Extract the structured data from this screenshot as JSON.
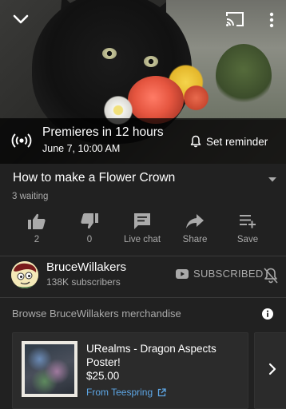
{
  "premiere": {
    "title": "Premieres in 12 hours",
    "date": "June 7, 10:00 AM",
    "reminder_label": "Set reminder"
  },
  "video": {
    "title": "How to make a Flower Crown",
    "waiting": "3 waiting"
  },
  "actions": [
    {
      "label": "2",
      "icon": "thumbs-up-icon"
    },
    {
      "label": "0",
      "icon": "thumbs-down-icon"
    },
    {
      "label": "Live chat",
      "icon": "chat-icon"
    },
    {
      "label": "Share",
      "icon": "share-icon"
    },
    {
      "label": "Save",
      "icon": "add-to-playlist-icon"
    }
  ],
  "channel": {
    "name": "BruceWillakers",
    "subscribers": "138K subscribers",
    "subscribed_label": "SUBSCRIBED"
  },
  "merch": {
    "heading": "Browse BruceWillakers merchandise",
    "item": {
      "title": "URealms - Dragon Aspects Poster!",
      "price": "$25.00",
      "source": "From Teespring"
    }
  },
  "colors": {
    "background": "#212121",
    "secondary_text": "#aaaaaa",
    "link": "#5ea7e6"
  }
}
